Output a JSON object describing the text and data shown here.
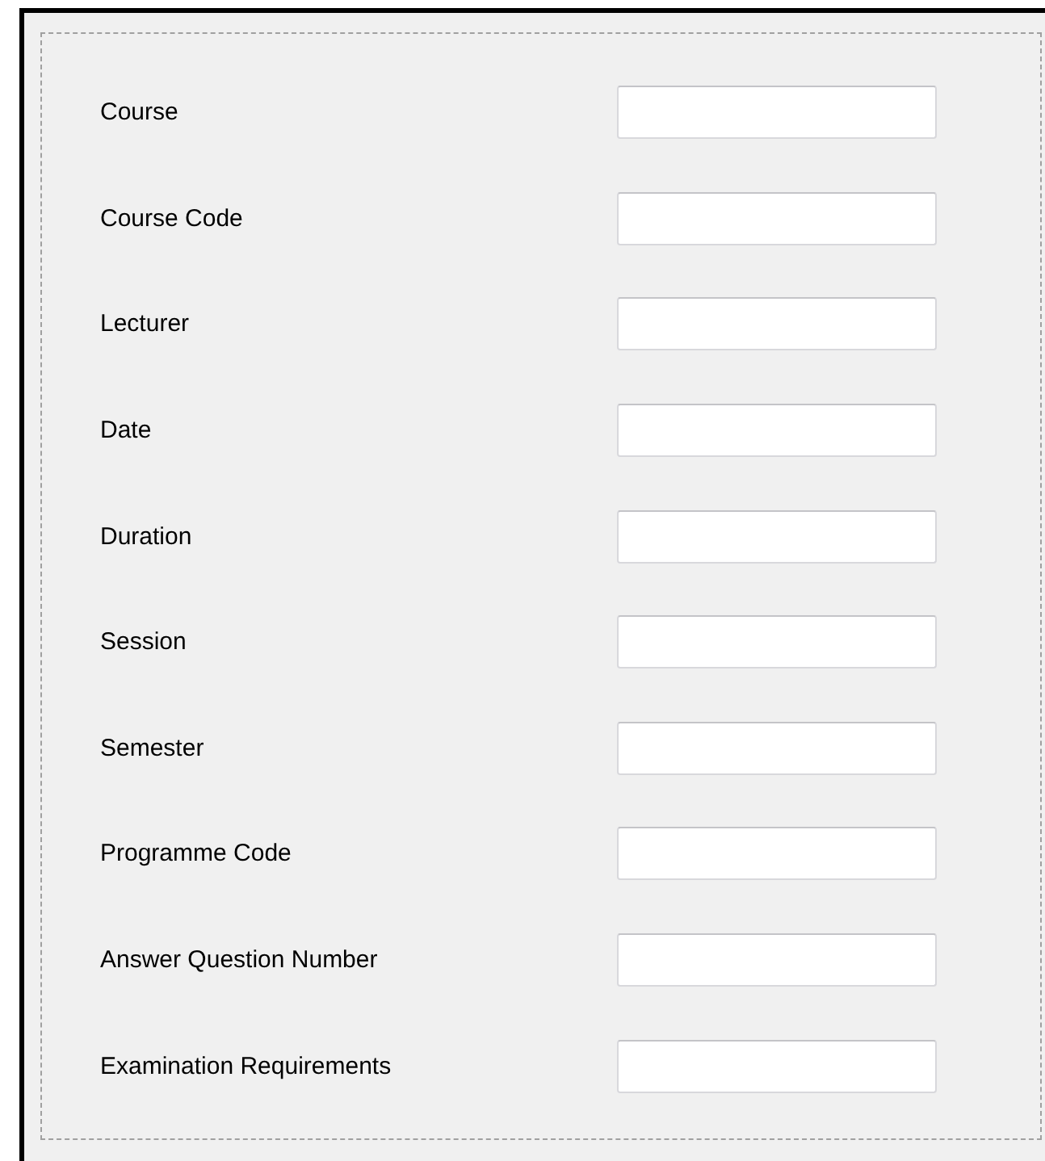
{
  "fields": [
    {
      "label": "Course"
    },
    {
      "label": "Course Code"
    },
    {
      "label": "Lecturer"
    },
    {
      "label": "Date"
    },
    {
      "label": "Duration"
    },
    {
      "label": "Session"
    },
    {
      "label": "Semester"
    },
    {
      "label": "Programme Code"
    },
    {
      "label": "Answer Question Number"
    },
    {
      "label": "Examination Requirements"
    }
  ]
}
